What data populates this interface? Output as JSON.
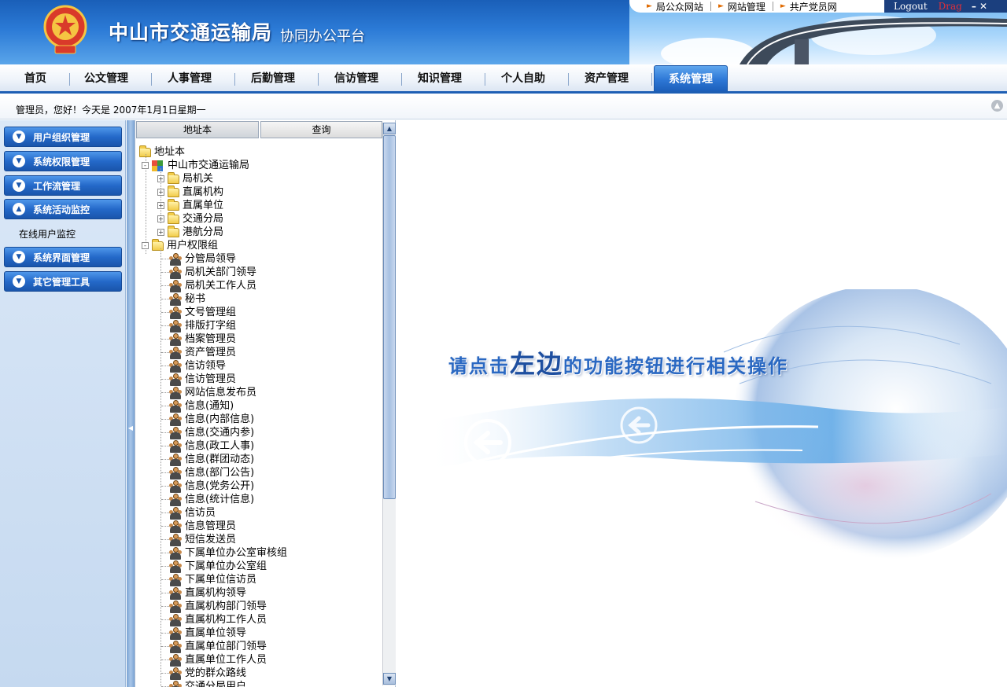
{
  "header": {
    "title": "中山市交通运输局",
    "subtitle": "协同办公平台",
    "top_links": [
      "局公众网站",
      "网站管理",
      "共产党员网"
    ],
    "logout": "Logout",
    "drag": "Drag",
    "window_buttons": "–  ✕"
  },
  "nav": {
    "items": [
      "首页",
      "公文管理",
      "人事管理",
      "后勤管理",
      "信访管理",
      "知识管理",
      "个人自助",
      "资产管理",
      "系统管理"
    ],
    "active_index": 8
  },
  "status": {
    "text": "管理员，您好！今天是 2007年1月1日星期一"
  },
  "sidebar": {
    "menus": [
      "用户组织管理",
      "系统权限管理",
      "工作流管理",
      "系统活动监控",
      "系统界面管理",
      "其它管理工具"
    ],
    "expanded_index": 3,
    "submenu": [
      "在线用户监控"
    ]
  },
  "tree_panel": {
    "tabs": [
      "地址本",
      "查询"
    ],
    "active_tab": 0,
    "root": "地址本",
    "org": "中山市交通运输局",
    "org_children": [
      "局机关",
      "直属机构",
      "直属单位",
      "交通分局",
      "港航分局"
    ],
    "groups_root": "用户权限组",
    "groups": [
      "分管局领导",
      "局机关部门领导",
      "局机关工作人员",
      "秘书",
      "文号管理组",
      "排版打字组",
      "档案管理员",
      "资产管理员",
      "信访领导",
      "信访管理员",
      "网站信息发布员",
      "信息(通知)",
      "信息(内部信息)",
      "信息(交通内参)",
      "信息(政工人事)",
      "信息(群团动态)",
      "信息(部门公告)",
      "信息(党务公开)",
      "信息(统计信息)",
      "信访员",
      "信息管理员",
      "短信发送员",
      "下属单位办公室审核组",
      "下属单位办公室组",
      "下属单位信访员",
      "直属机构领导",
      "直属机构部门领导",
      "直属机构工作人员",
      "直属单位领导",
      "直属单位部门领导",
      "直属单位工作人员",
      "党的群众路线",
      "交通分局用户"
    ]
  },
  "main": {
    "splash_prefix": "请点击",
    "splash_emph": "左边",
    "splash_suffix": "的功能按钮进行相关操作"
  },
  "colors": {
    "header_blue": "#2b7ad6",
    "nav_active": "#2d77d6",
    "sidebar_bg": "#c5d9f0",
    "menu_button": "#2469c9"
  }
}
